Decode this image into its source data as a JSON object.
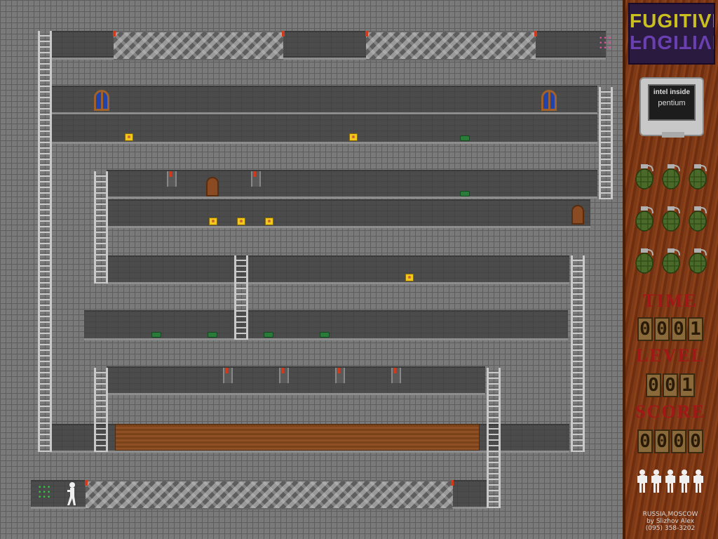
{
  "panel": {
    "logo_top": "FUGITIVE",
    "logo_bottom": "FUGITIVE",
    "monitor_chip": "intel inside",
    "monitor_name": "pentium",
    "time_label": "TIME",
    "time_digits": [
      "0",
      "0",
      "0",
      "1"
    ],
    "level_label": "LEVEL",
    "level_digits": [
      "0",
      "0",
      "1"
    ],
    "score_label": "SCORE",
    "score_digits": [
      "0",
      "0",
      "0",
      "0"
    ],
    "grenades_count": 9,
    "lives_count": 5,
    "credits": [
      "RUSSIA,MOSCOW",
      "by Slizhov Alex",
      "(095) 358-3202"
    ]
  },
  "colors": {
    "wall": "#7a7a7a",
    "corridor": "#4b4b4b",
    "panel_wood": "#7b3514",
    "label_red": "#a21818",
    "ladder": "#c9c9c9",
    "gold": "#f2c81a",
    "mine": "#2a7a3a"
  },
  "icons": {
    "gold": "gold-treasure-icon",
    "mine": "green-mine-icon",
    "grenade": "grenade-icon",
    "life": "player-life-icon",
    "door": "wooden-door-icon",
    "window": "arched-window-icon"
  }
}
